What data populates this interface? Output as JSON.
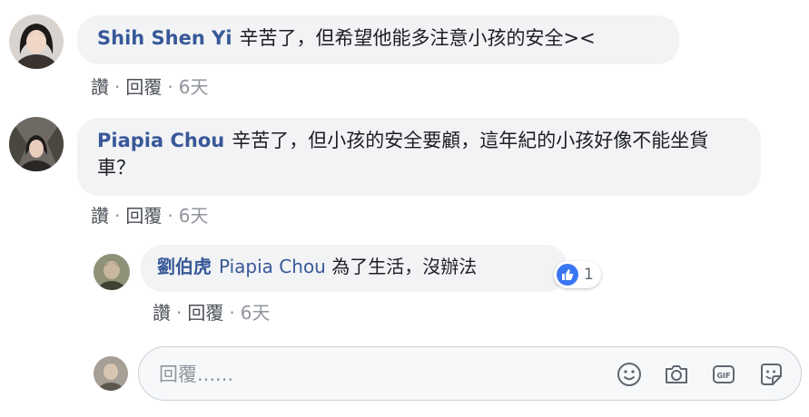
{
  "comments": [
    {
      "author": "Shih Shen Yi",
      "text": "辛苦了，但希望他能多注意小孩的安全><",
      "actions": {
        "like": "讚",
        "reply": "回覆",
        "time": "6天"
      }
    },
    {
      "author": "Piapia Chou",
      "text": "辛苦了，但小孩的安全要顧，這年紀的小孩好像不能坐貨車？",
      "actions": {
        "like": "讚",
        "reply": "回覆",
        "time": "6天"
      }
    }
  ],
  "reply": {
    "author": "劉伯虎",
    "mention": "Piapia Chou",
    "text": "為了生活，沒辦法",
    "reaction_count": "1",
    "actions": {
      "like": "讚",
      "reply": "回覆",
      "time": "6天"
    }
  },
  "reply_box": {
    "placeholder": "回覆......",
    "icons": [
      "emoji-icon",
      "camera-icon",
      "gif-icon",
      "sticker-icon"
    ]
  },
  "colors": {
    "author": "#385898",
    "bubble": "#f2f3f5",
    "like": "#3b76f2"
  }
}
